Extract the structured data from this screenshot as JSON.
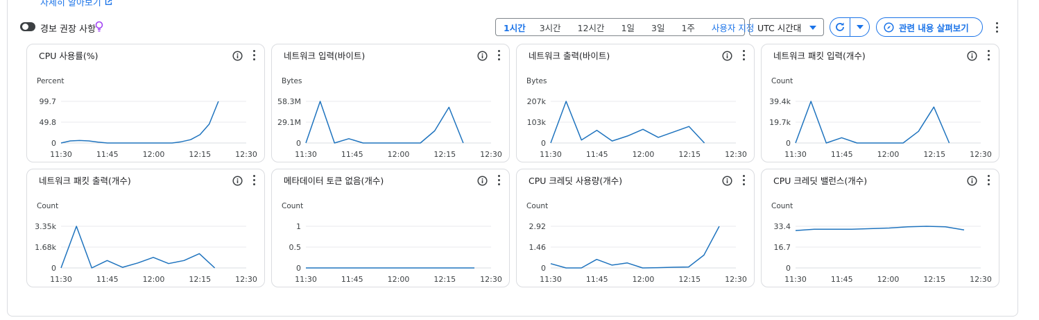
{
  "learn_more": {
    "label": "자세히 알아보기",
    "icon": "external-link-icon"
  },
  "toolbar": {
    "alert_label": "경보 권장 사항",
    "ranges": [
      "1시간",
      "3시간",
      "12시간",
      "1일",
      "3일",
      "1주"
    ],
    "active_range": "1시간",
    "custom_range": "사용자 지정",
    "timezone": "UTC 시간대",
    "explore": "관련 내용 살펴보기"
  },
  "colors": {
    "accent": "#1a73e8",
    "line": "#1e73be",
    "grid": "#e8eaed",
    "border": "#dadce0"
  },
  "x_ticks": [
    "11:30",
    "11:45",
    "12:00",
    "12:15",
    "12:30"
  ],
  "chart_data": [
    {
      "type": "line",
      "title": "CPU 사용률(%)",
      "unit": "Percent",
      "y_ticks": [
        "99.7",
        "49.8",
        "0"
      ],
      "ylim": [
        0,
        99.7
      ],
      "x": [
        "11:30",
        "11:33",
        "11:36",
        "11:39",
        "11:42",
        "11:45",
        "11:48",
        "11:51",
        "11:54",
        "11:57",
        "12:00",
        "12:03",
        "12:06",
        "12:09",
        "12:12",
        "12:15",
        "12:18"
      ],
      "values": [
        0,
        5,
        6,
        5,
        2,
        0,
        0,
        0,
        0,
        0,
        0,
        0,
        0,
        3,
        8,
        20,
        45,
        99.7
      ]
    },
    {
      "type": "line",
      "title": "네트워크 입력(바이트)",
      "unit": "Bytes",
      "y_ticks": [
        "58.3M",
        "29.1M",
        "0"
      ],
      "ylim": [
        0,
        58.3
      ],
      "values": [
        0,
        58.3,
        0,
        6,
        0,
        0,
        0,
        0,
        0,
        17,
        50,
        0
      ]
    },
    {
      "type": "line",
      "title": "네트워크 출력(바이트)",
      "unit": "Bytes",
      "y_ticks": [
        "207k",
        "103k",
        "0"
      ],
      "ylim": [
        0,
        207
      ],
      "values": [
        0,
        207,
        15,
        63,
        10,
        35,
        68,
        28,
        55,
        82,
        0
      ]
    },
    {
      "type": "line",
      "title": "네트워크 패킷 입력(개수)",
      "unit": "Count",
      "y_ticks": [
        "39.4k",
        "19.7k",
        "0"
      ],
      "ylim": [
        0,
        39.4
      ],
      "values": [
        0,
        39.4,
        0,
        5,
        0,
        0,
        0,
        0,
        11,
        34,
        0
      ]
    },
    {
      "type": "line",
      "title": "네트워크 패킷 출력(개수)",
      "unit": "Count",
      "y_ticks": [
        "3.35k",
        "1.68k",
        "0"
      ],
      "ylim": [
        0,
        3.35
      ],
      "values": [
        0,
        3.35,
        0,
        0.6,
        0.05,
        0.4,
        0.85,
        0.35,
        0.6,
        1.15,
        0
      ]
    },
    {
      "type": "line",
      "title": "메타데이터 토큰 없음(개수)",
      "unit": "Count",
      "y_ticks": [
        "1",
        "0.5",
        "0"
      ],
      "ylim": [
        0,
        1
      ],
      "values": [
        0,
        0,
        0,
        0,
        0,
        0,
        0,
        0,
        0,
        0,
        0,
        0
      ]
    },
    {
      "type": "line",
      "title": "CPU 크레딧 사용량(개수)",
      "unit": "Count",
      "y_ticks": [
        "2.92",
        "1.46",
        "0"
      ],
      "ylim": [
        0,
        2.92
      ],
      "values": [
        0.3,
        0,
        0,
        0.6,
        0.2,
        0.35,
        0,
        0.02,
        0.05,
        0.07,
        0.9,
        2.92
      ]
    },
    {
      "type": "line",
      "title": "CPU 크레딧 밸런스(개수)",
      "unit": "Count",
      "y_ticks": [
        "33.4",
        "16.7",
        "0"
      ],
      "ylim": [
        0,
        33.4
      ],
      "values": [
        30,
        31,
        31,
        31,
        31.5,
        32,
        33,
        33.4,
        33,
        30.5
      ]
    }
  ]
}
